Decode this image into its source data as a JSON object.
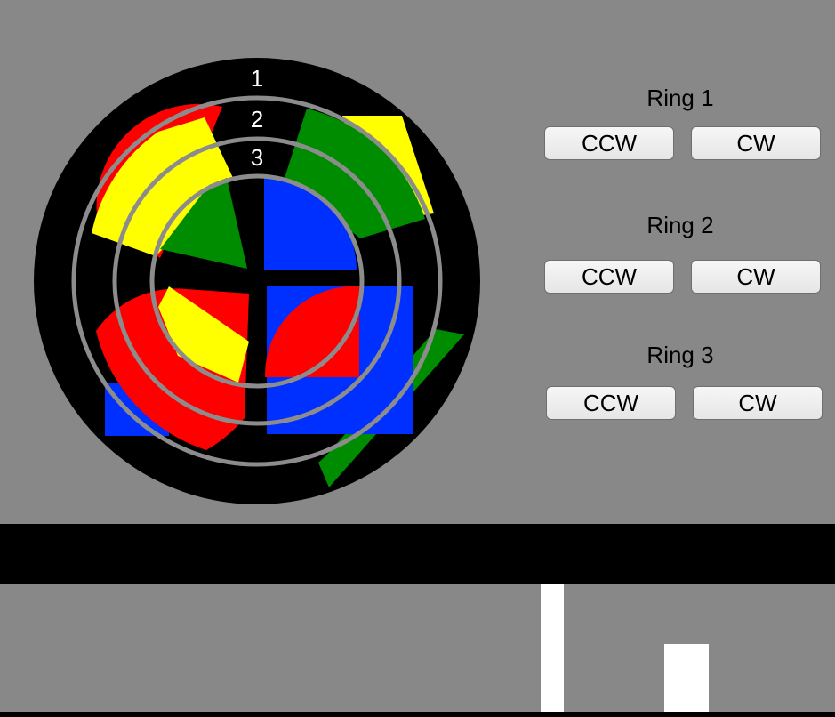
{
  "puzzle": {
    "ring_numbers": [
      "1",
      "2",
      "3"
    ],
    "colors": {
      "background": "#888888",
      "disc": "#000000",
      "ring_line": "#8c8c8c",
      "red": "#ff0000",
      "yellow": "#ffff00",
      "green": "#008c00",
      "blue": "#0030ff",
      "white": "#ffffff"
    }
  },
  "controls": {
    "rings": [
      {
        "label": "Ring 1",
        "ccw": "CCW",
        "cw": "CW"
      },
      {
        "label": "Ring 2",
        "ccw": "CCW",
        "cw": "CW"
      },
      {
        "label": "Ring 3",
        "ccw": "CCW",
        "cw": "CW"
      }
    ]
  }
}
